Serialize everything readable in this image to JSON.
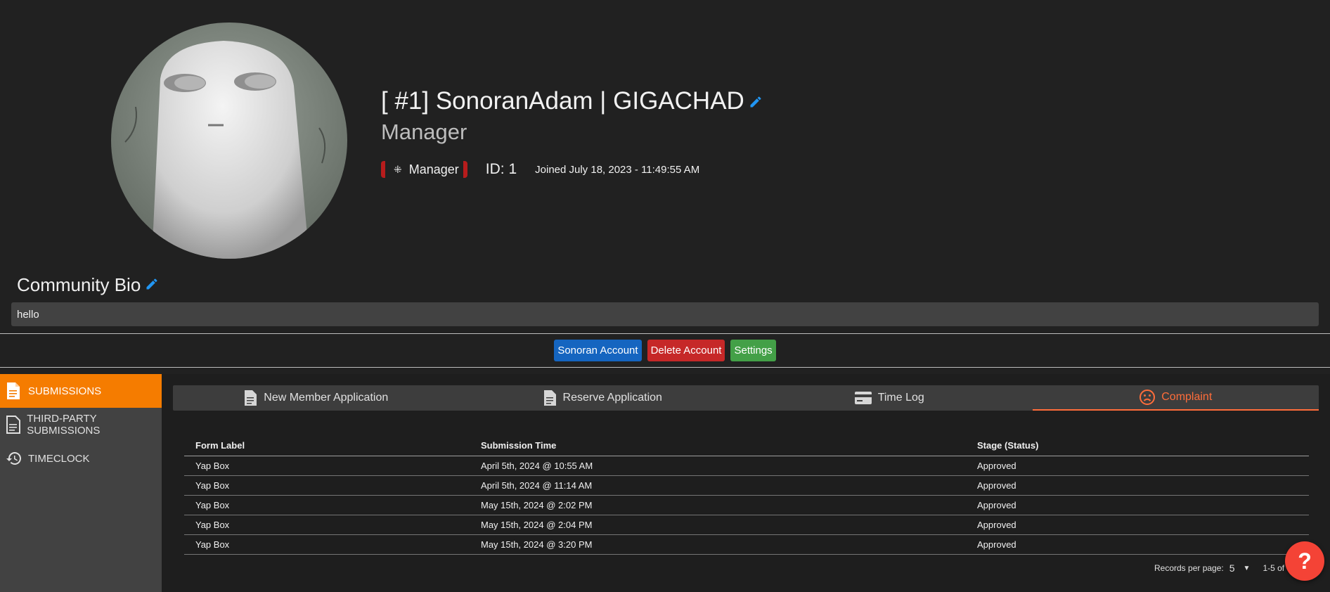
{
  "profile": {
    "name": "[ #1] SonoranAdam | GIGACHAD",
    "role_title": "Manager",
    "role_badge": "Manager",
    "id_label": "ID: 1",
    "joined": "Joined July 18, 2023 - 11:49:55 AM"
  },
  "bio": {
    "title": "Community Bio",
    "text": "hello"
  },
  "actions": {
    "sonoran_account": "Sonoran Account",
    "delete_account": "Delete Account",
    "settings": "Settings"
  },
  "sidebar": {
    "items": [
      {
        "label": "SUBMISSIONS",
        "icon": "document-icon",
        "active": true
      },
      {
        "label": "THIRD-PARTY SUBMISSIONS",
        "icon": "document-outline-icon",
        "active": false
      },
      {
        "label": "TIMECLOCK",
        "icon": "history-icon",
        "active": false
      }
    ]
  },
  "tabs": [
    {
      "label": "New Member Application",
      "icon": "document-icon",
      "active": false
    },
    {
      "label": "Reserve Application",
      "icon": "document-icon",
      "active": false
    },
    {
      "label": "Time Log",
      "icon": "card-icon",
      "active": false
    },
    {
      "label": "Complaint",
      "icon": "sad-face-icon",
      "active": true
    }
  ],
  "table": {
    "headers": [
      "Form Label",
      "Submission Time",
      "Stage (Status)"
    ],
    "rows": [
      [
        "Yap Box",
        "April 5th, 2024 @ 10:55 AM",
        "Approved"
      ],
      [
        "Yap Box",
        "April 5th, 2024 @ 11:14 AM",
        "Approved"
      ],
      [
        "Yap Box",
        "May 15th, 2024 @ 2:02 PM",
        "Approved"
      ],
      [
        "Yap Box",
        "May 15th, 2024 @ 2:04 PM",
        "Approved"
      ],
      [
        "Yap Box",
        "May 15th, 2024 @ 3:20 PM",
        "Approved"
      ]
    ]
  },
  "pager": {
    "label": "Records per page:",
    "per_page": "5",
    "range": "1-5 of"
  },
  "help": {
    "label": "?"
  },
  "colors": {
    "accent_orange": "#f57c00",
    "active_tab": "#ff6d3a",
    "blue_button": "#1565c0",
    "red_button": "#c62828",
    "green_button": "#43a047",
    "edit_icon": "#2196f3",
    "help_button": "#f44336"
  }
}
